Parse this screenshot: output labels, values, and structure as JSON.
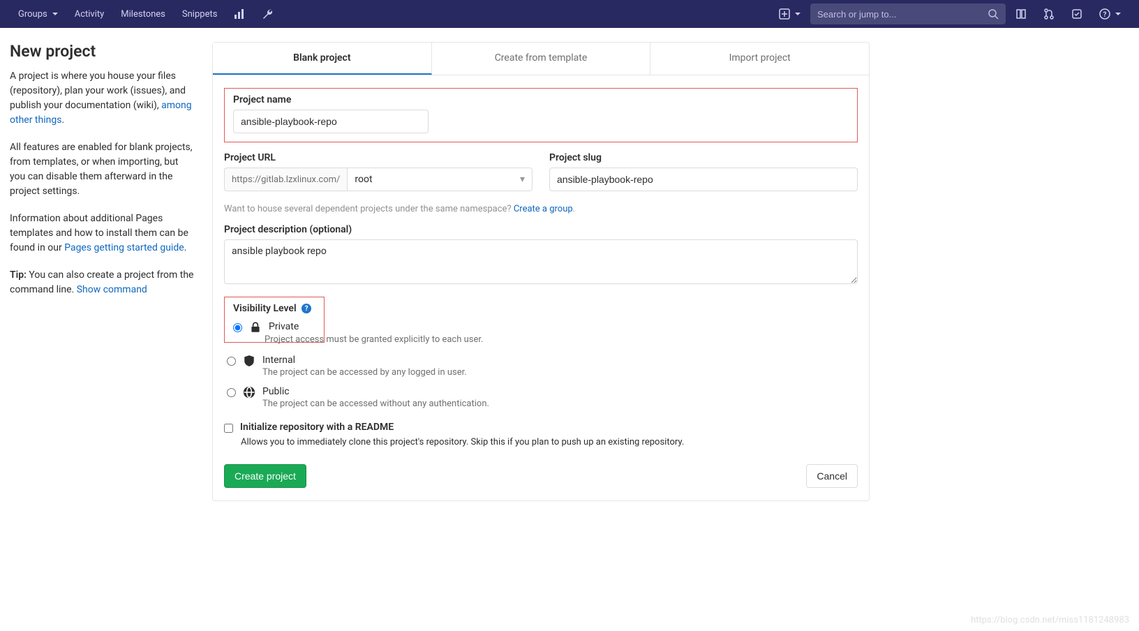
{
  "navbar": {
    "groups": "Groups",
    "activity": "Activity",
    "milestones": "Milestones",
    "snippets": "Snippets",
    "search_placeholder": "Search or jump to..."
  },
  "sidebar": {
    "title": "New project",
    "p1_prefix": "A project is where you house your files (repository), plan your work (issues), and publish your documentation (wiki), ",
    "p1_link": "among other things",
    "p2": "All features are enabled for blank projects, from templates, or when importing, but you can disable them afterward in the project settings.",
    "p3_prefix": "Information about additional Pages templates and how to install them can be found in our ",
    "p3_link": "Pages getting started guide",
    "tip_label": "Tip:",
    "tip_text": " You can also create a project from the command line. ",
    "tip_link": "Show command"
  },
  "tabs": {
    "blank": "Blank project",
    "template": "Create from template",
    "import": "Import project"
  },
  "form": {
    "project_name_label": "Project name",
    "project_name_value": "ansible-playbook-repo",
    "project_url_label": "Project URL",
    "project_url_prefix": "https://gitlab.lzxlinux.com/",
    "project_url_namespace": "root",
    "project_slug_label": "Project slug",
    "project_slug_value": "ansible-playbook-repo",
    "group_hint_prefix": "Want to house several dependent projects under the same namespace? ",
    "group_hint_link": "Create a group",
    "description_label": "Project description (optional)",
    "description_value": "ansible playbook repo",
    "visibility_label": "Visibility Level",
    "visibility": {
      "private": {
        "title": "Private",
        "desc": "Project access must be granted explicitly to each user."
      },
      "internal": {
        "title": "Internal",
        "desc": "The project can be accessed by any logged in user."
      },
      "public": {
        "title": "Public",
        "desc": "The project can be accessed without any authentication."
      }
    },
    "readme_label": "Initialize repository with a README",
    "readme_desc": "Allows you to immediately clone this project's repository. Skip this if you plan to push up an existing repository.",
    "create_btn": "Create project",
    "cancel_btn": "Cancel"
  },
  "watermark": "https://blog.csdn.net/miss1181248983"
}
